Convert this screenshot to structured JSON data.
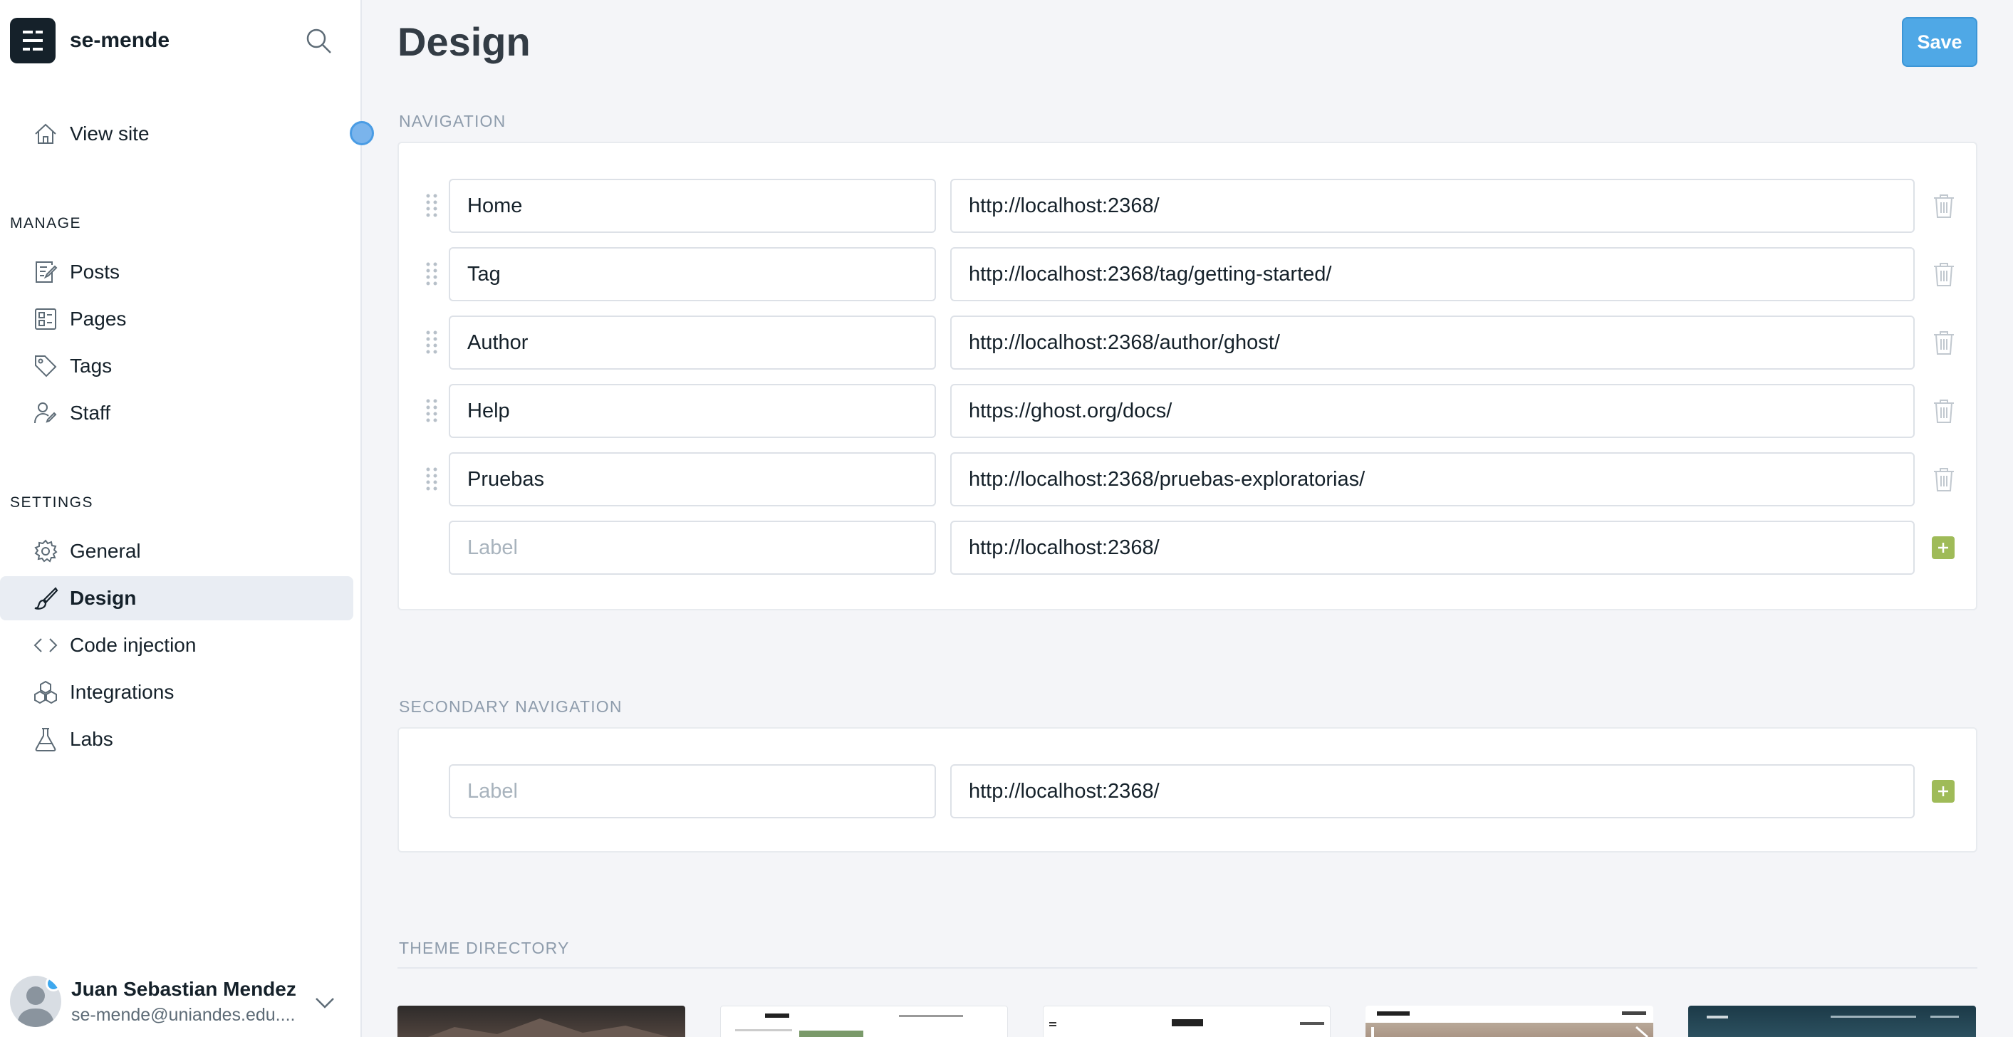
{
  "sidebar": {
    "site_name": "se-mende",
    "view_site": "View site",
    "manage_title": "MANAGE",
    "manage_items": [
      "Posts",
      "Pages",
      "Tags",
      "Staff"
    ],
    "settings_title": "SETTINGS",
    "settings_items": [
      "General",
      "Design",
      "Code injection",
      "Integrations",
      "Labs"
    ],
    "active_item": "Design",
    "user_name": "Juan Sebastian Mendez",
    "user_email": "se-mende@uniandes.edu...."
  },
  "header": {
    "title": "Design",
    "save_label": "Save"
  },
  "navigation": {
    "section_label": "NAVIGATION",
    "items": [
      {
        "label": "Home",
        "url": "http://localhost:2368/"
      },
      {
        "label": "Tag",
        "url": "http://localhost:2368/tag/getting-started/"
      },
      {
        "label": "Author",
        "url": "http://localhost:2368/author/ghost/"
      },
      {
        "label": "Help",
        "url": "https://ghost.org/docs/"
      },
      {
        "label": "Pruebas",
        "url": "http://localhost:2368/pruebas-exploratorias/"
      }
    ],
    "new_label_placeholder": "Label",
    "new_url_value": "http://localhost:2368/"
  },
  "secondary_navigation": {
    "section_label": "SECONDARY NAVIGATION",
    "new_label_placeholder": "Label",
    "new_url_value": "http://localhost:2368/"
  },
  "theme_directory": {
    "section_label": "THEME DIRECTORY",
    "thumbnails": [
      "dark-mountain",
      "light-minimal",
      "light-pacific",
      "farafra-photo",
      "dark-ocean"
    ]
  },
  "colors": {
    "accent": "#4fa8e6",
    "add_green": "#9fbb58",
    "sidebar_active": "#e9edf3"
  }
}
